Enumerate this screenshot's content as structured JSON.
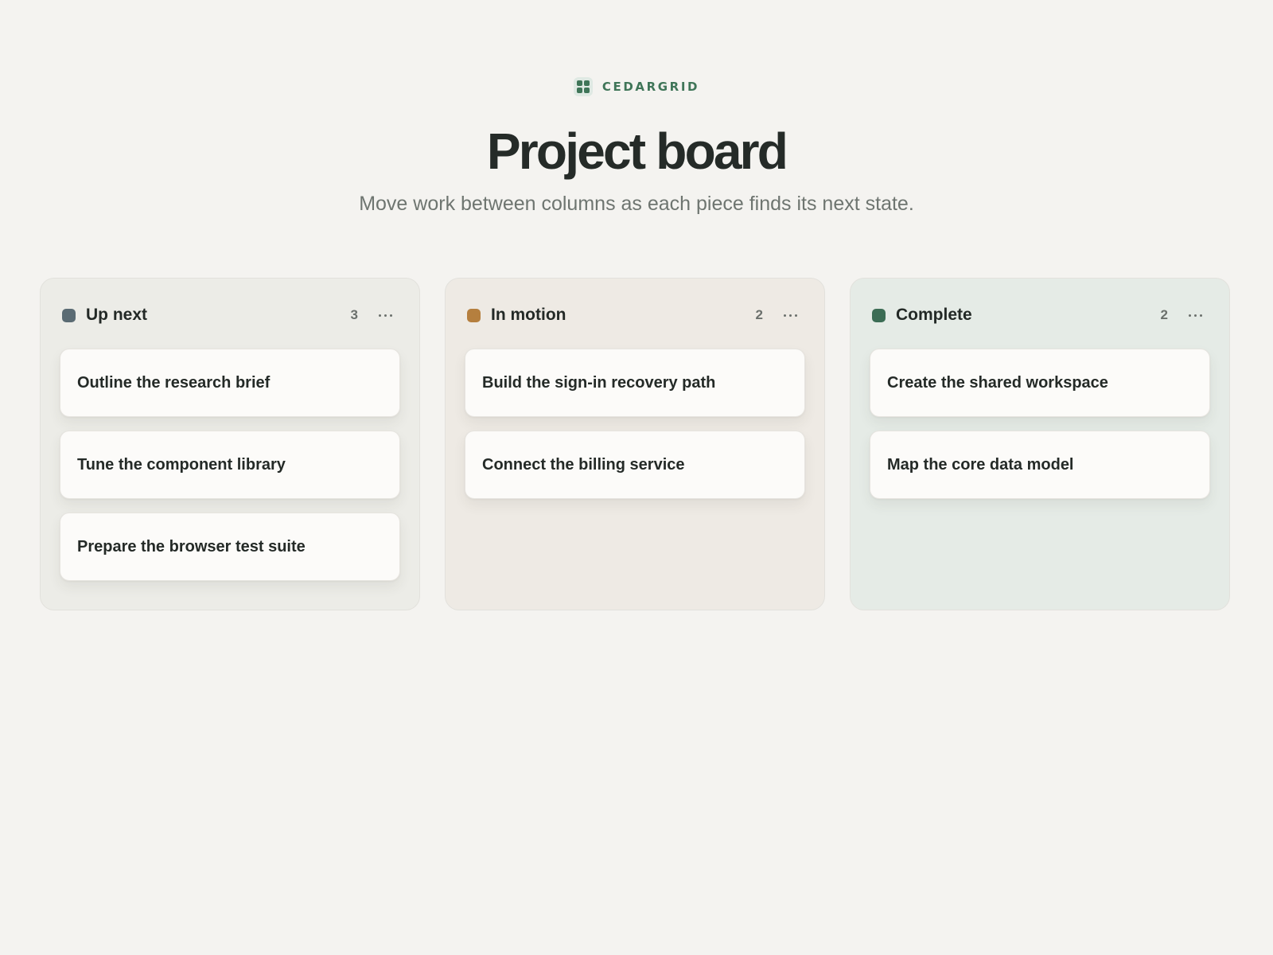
{
  "brand": {
    "name": "CEDARGRID",
    "icon": "grid-icon",
    "accent_color": "#3f7558"
  },
  "header": {
    "title": "Project board",
    "subtitle": "Move work between columns as each piece finds its next state."
  },
  "columns": [
    {
      "title": "Up next",
      "count": "3",
      "dot_color": "#5a6b73",
      "menu_icon": "more-horizontal-icon",
      "cards": [
        {
          "title": "Outline the research brief"
        },
        {
          "title": "Tune the component library"
        },
        {
          "title": "Prepare the browser test suite"
        }
      ]
    },
    {
      "title": "In motion",
      "count": "2",
      "dot_color": "#b57f3e",
      "menu_icon": "more-horizontal-icon",
      "cards": [
        {
          "title": "Build the sign-in recovery path"
        },
        {
          "title": "Connect the billing service"
        }
      ]
    },
    {
      "title": "Complete",
      "count": "2",
      "dot_color": "#3c6d55",
      "menu_icon": "more-horizontal-icon",
      "cards": [
        {
          "title": "Create the shared workspace"
        },
        {
          "title": "Map the core data model"
        }
      ]
    }
  ]
}
